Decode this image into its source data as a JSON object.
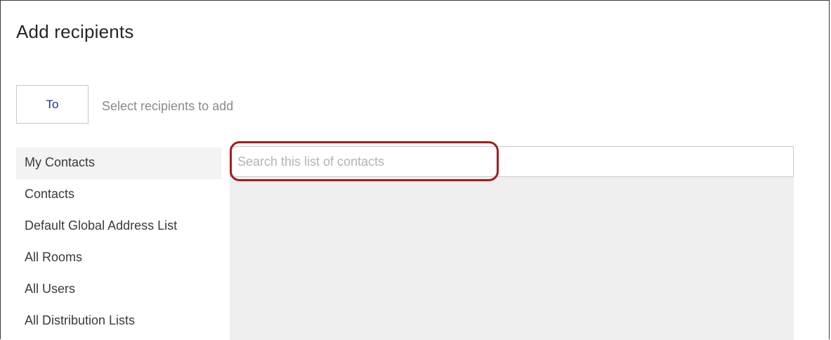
{
  "dialog": {
    "title": "Add recipients"
  },
  "recipients": {
    "to_label": "To",
    "placeholder": "Select recipients to add"
  },
  "sidebar": {
    "items": [
      {
        "label": "My Contacts",
        "selected": true
      },
      {
        "label": "Contacts",
        "selected": false
      },
      {
        "label": "Default Global Address List",
        "selected": false
      },
      {
        "label": "All Rooms",
        "selected": false
      },
      {
        "label": "All Users",
        "selected": false
      },
      {
        "label": "All Distribution Lists",
        "selected": false
      }
    ]
  },
  "search": {
    "value": "",
    "placeholder": "Search this list of contacts"
  },
  "colors": {
    "to_label": "#1f2f9a",
    "highlight": "#a31d1d",
    "panel_background": "#efefef"
  }
}
